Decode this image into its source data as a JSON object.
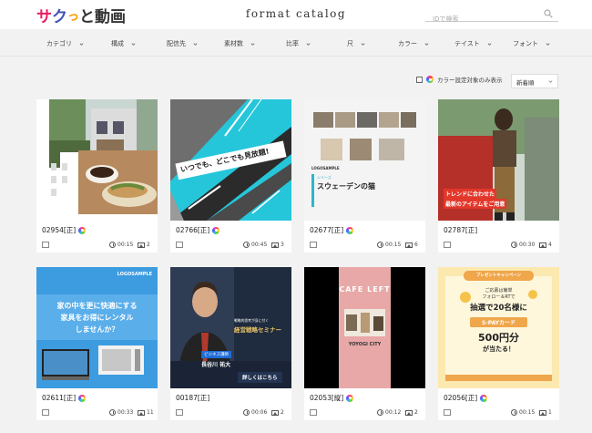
{
  "header": {
    "logo_chars": [
      "サ",
      "ク",
      "っ",
      "と",
      "動",
      "画"
    ],
    "logo_colors": [
      "#e91e63",
      "#3f51b5",
      "#ff9800",
      "#333333",
      "#333333",
      "#333333"
    ],
    "site_title": "format catalog",
    "search_placeholder": "IDで検索"
  },
  "filters": [
    {
      "label": "カテゴリ"
    },
    {
      "label": "構成"
    },
    {
      "label": "配信先"
    },
    {
      "label": "素材数"
    },
    {
      "label": "比率"
    },
    {
      "label": "尺"
    },
    {
      "label": "カラー"
    },
    {
      "label": "テイスト"
    },
    {
      "label": "フォント"
    }
  ],
  "options": {
    "color_filter_label": "カラー設定対象のみ表示",
    "sort_label": "新着順"
  },
  "cards": [
    {
      "code": "02954[正]",
      "duration": "00:15",
      "images": "2",
      "color_settable": true
    },
    {
      "code": "02766[正]",
      "duration": "00:45",
      "images": "3",
      "color_settable": true,
      "thumb_text": "いつでも、どこでも見放題!"
    },
    {
      "code": "02677[正]",
      "duration": "00:15",
      "images": "6",
      "color_settable": true,
      "thumb_logo": "LOGOSAMPLE",
      "thumb_series": "シリーズ",
      "thumb_title": "スウェーデンの猫"
    },
    {
      "code": "02787[正]",
      "duration": "00:30",
      "images": "4",
      "color_settable": false,
      "thumb_line1": "トレンドに合わせた",
      "thumb_line2": "最新のアイテムをご用意"
    },
    {
      "code": "02611[正]",
      "duration": "00:33",
      "images": "11",
      "color_settable": true,
      "thumb_logo": "LOGOSAMPLE",
      "thumb_line1": "家の中を更に快適にする",
      "thumb_line2": "家具をお得にレンタル",
      "thumb_line3": "しませんか？"
    },
    {
      "code": "00187[正]",
      "duration": "00:06",
      "images": "2",
      "color_settable": false,
      "thumb_line1": "戦略的思考が身に付く",
      "thumb_title": "経営戦略セミナー",
      "thumb_badge": "ビジネス講師",
      "thumb_name": "長谷川 祐大",
      "thumb_cta": "詳しくはこちら"
    },
    {
      "code": "02053[縦]",
      "duration": "00:12",
      "images": "2",
      "color_settable": true,
      "thumb_title": "CAFE LEFT",
      "thumb_sub": "YOYOGI CITY"
    },
    {
      "code": "02056[正]",
      "duration": "00:15",
      "images": "1",
      "color_settable": true,
      "thumb_banner": "プレゼントキャンペーン",
      "thumb_line1": "ご応募は簡単",
      "thumb_line2": "フォロー＆RTで",
      "thumb_line3": "抽選で20名様に",
      "thumb_badge": "S-PAYカード",
      "thumb_title": "500円分",
      "thumb_sub": "が当たる！"
    }
  ],
  "colors": {
    "accent_cyan": "#29c4d6",
    "accent_red": "#e2382b",
    "dark_navy": "#1f2b3e"
  }
}
